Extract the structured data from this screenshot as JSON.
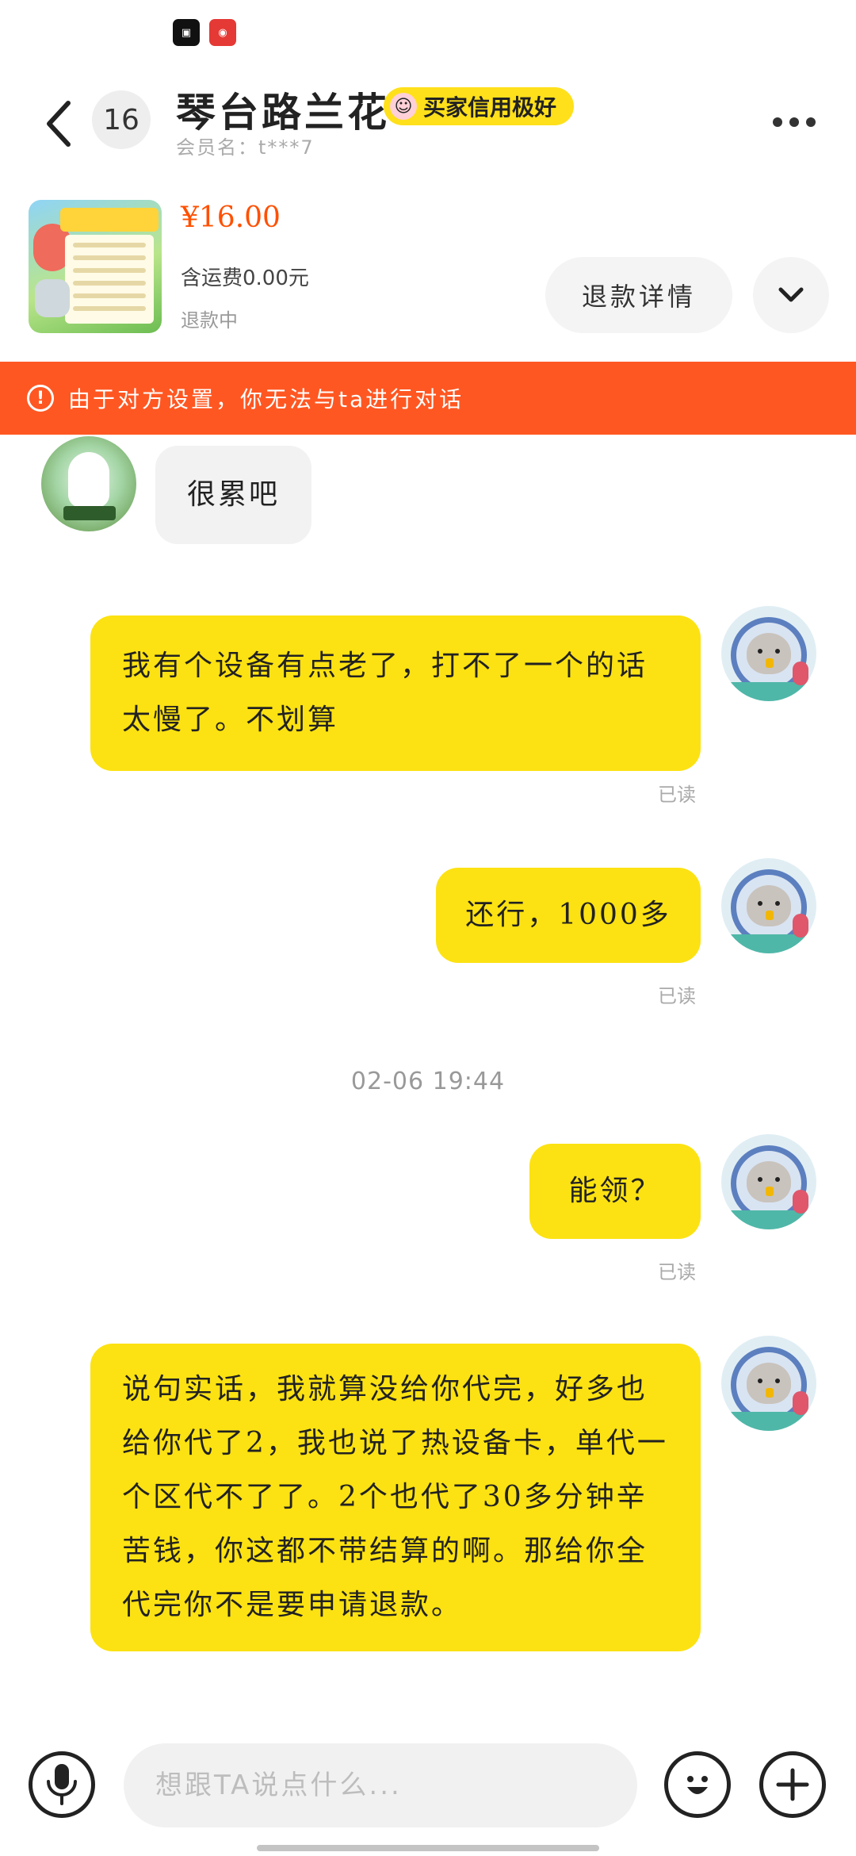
{
  "status_bar": {
    "icons": [
      "app-icon-1",
      "app-icon-2"
    ]
  },
  "header": {
    "unread_count": "16",
    "title": "琴台路兰花",
    "credit_badge": "买家信用极好",
    "member": "会员名：t***7"
  },
  "product": {
    "price": "¥16.00",
    "shipping": "含运费0.00元",
    "status": "退款中",
    "refund_button": "退款详情"
  },
  "warning": {
    "text": "由于对方设置，你无法与ta进行对话"
  },
  "messages": [
    {
      "from": "other",
      "text": "很累吧"
    },
    {
      "from": "self",
      "text": "我有个设备有点老了，打不了一个的话太慢了。不划算",
      "read": "已读"
    },
    {
      "from": "self",
      "text": "还行，1000多",
      "read": "已读"
    },
    {
      "from": "self",
      "text": "能领？",
      "read": "已读"
    },
    {
      "from": "self",
      "text": "说句实话，我就算没给你代完，好多也给你代了2，我也说了热设备卡，单代一个区代不了了。2个也代了30多分钟辛苦钱，你这都不带结算的啊。那给你全代完你不是要申请退款。"
    }
  ],
  "timestamp": "02-06 19:44",
  "input": {
    "placeholder": "想跟TA说点什么..."
  },
  "colors": {
    "accent_yellow": "#fce212",
    "warning_orange": "#ff5722",
    "price_orange": "#ff5000"
  }
}
